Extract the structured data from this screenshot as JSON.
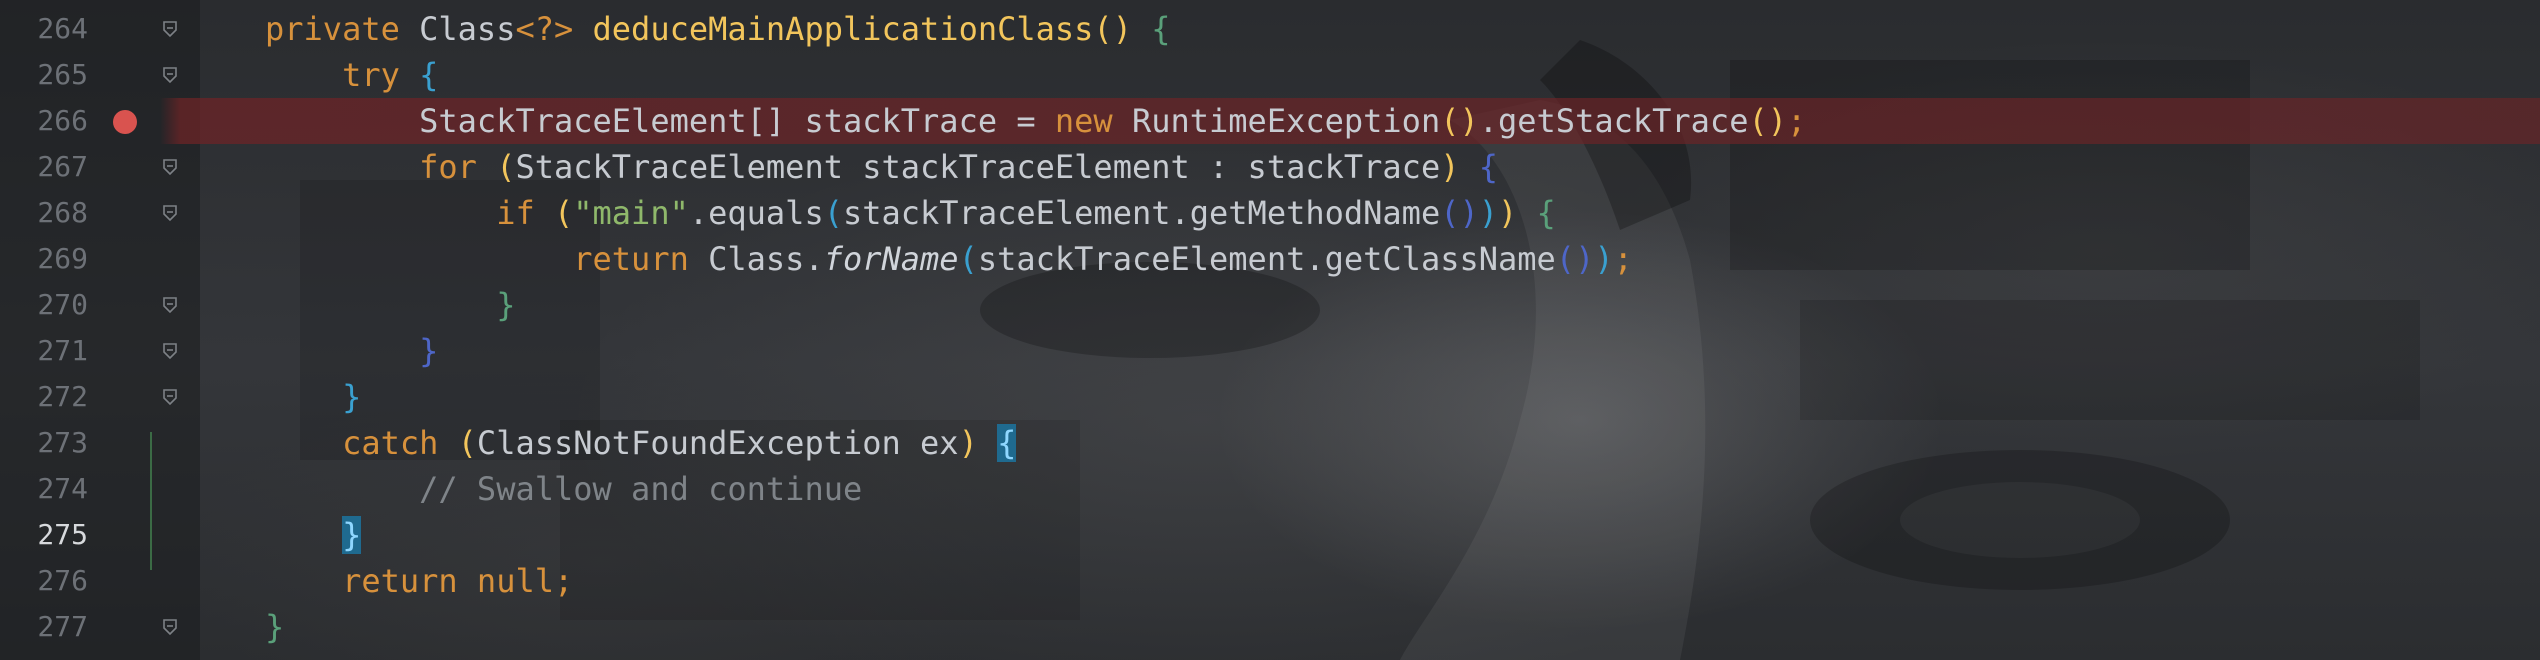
{
  "editor": {
    "lines": [
      {
        "number": "264",
        "segments": [
          {
            "t": "private ",
            "c": "kw"
          },
          {
            "t": "Class",
            "c": "cl"
          },
          {
            "t": "<?> ",
            "c": "kw"
          },
          {
            "t": "deduceMainApplicationClass",
            "c": "fn"
          },
          {
            "t": "() ",
            "c": "p1"
          },
          {
            "t": "{",
            "c": "p3"
          }
        ]
      },
      {
        "number": "265",
        "segments": [
          {
            "t": "    try ",
            "c": "kw"
          },
          {
            "t": "{",
            "c": "p2"
          }
        ]
      },
      {
        "number": "266",
        "breakpoint": true,
        "segments": [
          {
            "t": "        StackTraceElement[] stackTrace = ",
            "c": "cl"
          },
          {
            "t": "new ",
            "c": "kw"
          },
          {
            "t": "RuntimeException",
            "c": "cl"
          },
          {
            "t": "()",
            "c": "p1"
          },
          {
            "t": ".getStackTrace",
            "c": "cl"
          },
          {
            "t": "()",
            "c": "p1"
          },
          {
            "t": ";",
            "c": "kw"
          }
        ]
      },
      {
        "number": "267",
        "segments": [
          {
            "t": "        for ",
            "c": "kw"
          },
          {
            "t": "(",
            "c": "p1"
          },
          {
            "t": "StackTraceElement stackTraceElement : stackTrace",
            "c": "cl"
          },
          {
            "t": ") ",
            "c": "p1"
          },
          {
            "t": "{",
            "c": "p4"
          }
        ]
      },
      {
        "number": "268",
        "segments": [
          {
            "t": "            if ",
            "c": "kw"
          },
          {
            "t": "(",
            "c": "p1"
          },
          {
            "t": "\"main\"",
            "c": "str"
          },
          {
            "t": ".equals",
            "c": "cl"
          },
          {
            "t": "(",
            "c": "p2"
          },
          {
            "t": "stackTraceElement.getMethodName",
            "c": "cl"
          },
          {
            "t": "()",
            "c": "p4"
          },
          {
            "t": ")",
            "c": "p2"
          },
          {
            "t": ") ",
            "c": "p1"
          },
          {
            "t": "{",
            "c": "p3"
          }
        ]
      },
      {
        "number": "269",
        "segments": [
          {
            "t": "                return ",
            "c": "kw"
          },
          {
            "t": "Class.",
            "c": "cl"
          },
          {
            "t": "forName",
            "c": "it"
          },
          {
            "t": "(",
            "c": "p2"
          },
          {
            "t": "stackTraceElement.getClassName",
            "c": "cl"
          },
          {
            "t": "()",
            "c": "p4"
          },
          {
            "t": ")",
            "c": "p2"
          },
          {
            "t": ";",
            "c": "kw"
          }
        ]
      },
      {
        "number": "270",
        "segments": [
          {
            "t": "            }",
            "c": "p3"
          }
        ]
      },
      {
        "number": "271",
        "segments": [
          {
            "t": "        }",
            "c": "p4"
          }
        ]
      },
      {
        "number": "272",
        "segments": [
          {
            "t": "    }",
            "c": "p2"
          }
        ]
      },
      {
        "number": "273",
        "segments": [
          {
            "t": "    catch ",
            "c": "kw"
          },
          {
            "t": "(",
            "c": "p1"
          },
          {
            "t": "ClassNotFoundException ex",
            "c": "cl"
          },
          {
            "t": ") ",
            "c": "p1"
          },
          {
            "t": "{",
            "c": "match"
          }
        ]
      },
      {
        "number": "274",
        "segments": [
          {
            "t": "        // Swallow and continue",
            "c": "cm"
          }
        ]
      },
      {
        "number": "275",
        "current": true,
        "segments": [
          {
            "t": "    ",
            "c": "cl"
          },
          {
            "t": "}",
            "c": "match"
          }
        ]
      },
      {
        "number": "276",
        "segments": [
          {
            "t": "    return null",
            "c": "kw"
          },
          {
            "t": ";",
            "c": "kw"
          }
        ]
      },
      {
        "number": "277",
        "segments": [
          {
            "t": "}",
            "c": "p3"
          }
        ]
      }
    ]
  }
}
